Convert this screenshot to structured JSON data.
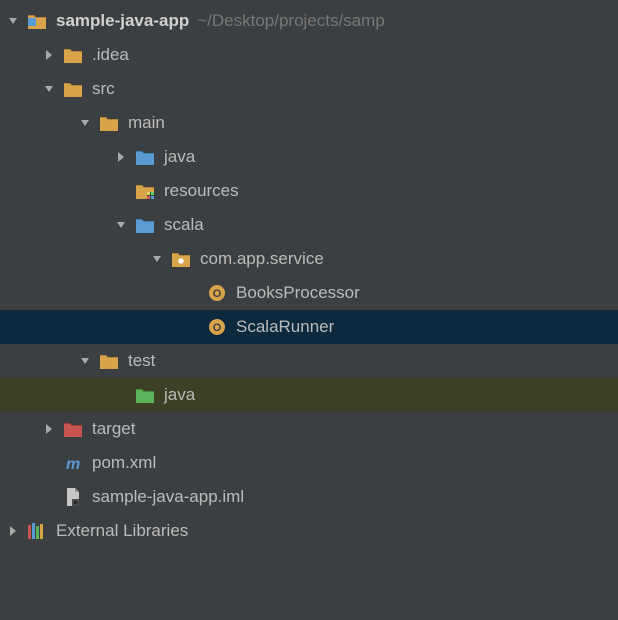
{
  "tree": {
    "root": {
      "name": "sample-java-app",
      "path": "~/Desktop/projects/samp"
    },
    "idea": ".idea",
    "src": "src",
    "main": "main",
    "java": "java",
    "resources": "resources",
    "scala": "scala",
    "package": "com.app.service",
    "booksProcessor": "BooksProcessor",
    "scalaRunner": "ScalaRunner",
    "test": "test",
    "testJava": "java",
    "target": "target",
    "pom": "pom.xml",
    "iml": "sample-java-app.iml",
    "externalLibs": "External Libraries"
  }
}
